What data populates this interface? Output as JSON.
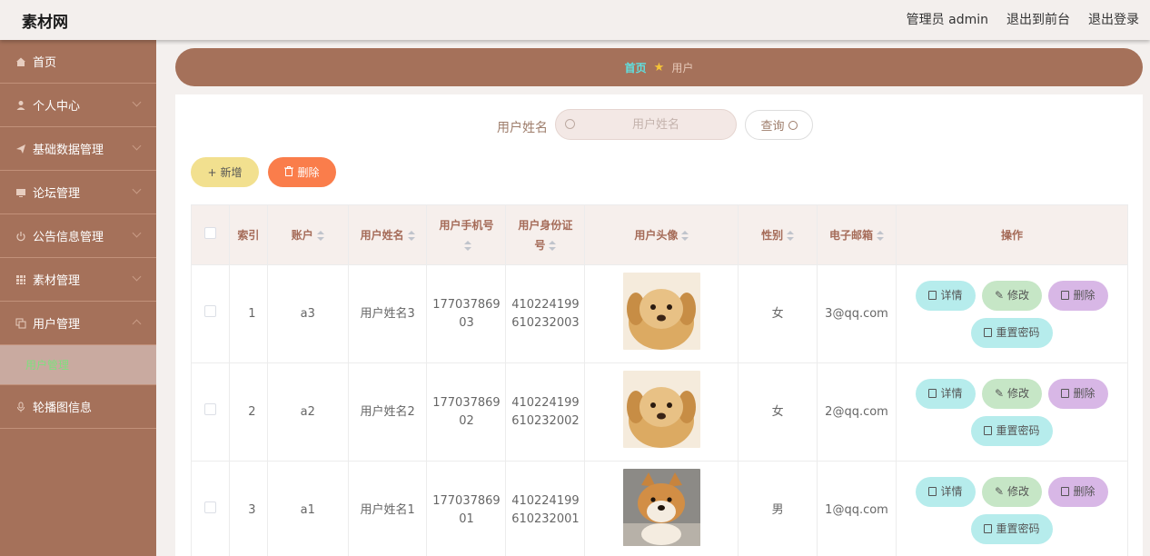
{
  "app": {
    "title": "素材网"
  },
  "header": {
    "admin_label": "管理员 admin",
    "frontend_link": "退出到前台",
    "logout_link": "退出登录"
  },
  "sidebar": {
    "items": [
      {
        "label": "首页",
        "icon": "home-icon"
      },
      {
        "label": "个人中心",
        "icon": "user-icon"
      },
      {
        "label": "基础数据管理",
        "icon": "send-icon"
      },
      {
        "label": "论坛管理",
        "icon": "monitor-icon"
      },
      {
        "label": "公告信息管理",
        "icon": "power-icon"
      },
      {
        "label": "素材管理",
        "icon": "grid-icon"
      },
      {
        "label": "用户管理",
        "icon": "copy-icon"
      },
      {
        "label": "轮播图信息",
        "icon": "mic-icon"
      }
    ],
    "active_sub": "用户管理"
  },
  "breadcrumb": {
    "home": "首页",
    "current": "用户"
  },
  "search": {
    "label": "用户姓名",
    "placeholder": "用户姓名",
    "value": "",
    "button_label": "查询"
  },
  "toolbar": {
    "add_label": "新增",
    "delete_label": "删除"
  },
  "table": {
    "headers": {
      "index": "索引",
      "account": "账户",
      "name": "用户姓名",
      "phone_line1": "用户手机号",
      "idcard_line1": "用户身份证",
      "idcard_line2": "号",
      "avatar": "用户头像",
      "gender": "性别",
      "email": "电子邮箱",
      "actions": "操作"
    },
    "rows": [
      {
        "index": "1",
        "account": "a3",
        "name": "用户姓名3",
        "phone_l1": "177037869",
        "phone_l2": "03",
        "id_l1": "410224199",
        "id_l2": "610232003",
        "avatar": "golden-puppy",
        "gender": "女",
        "email": "3@qq.com"
      },
      {
        "index": "2",
        "account": "a2",
        "name": "用户姓名2",
        "phone_l1": "177037869",
        "phone_l2": "02",
        "id_l1": "410224199",
        "id_l2": "610232002",
        "avatar": "golden-puppy",
        "gender": "女",
        "email": "2@qq.com"
      },
      {
        "index": "3",
        "account": "a1",
        "name": "用户姓名1",
        "phone_l1": "177037869",
        "phone_l2": "01",
        "id_l1": "410224199",
        "id_l2": "610232001",
        "avatar": "shiba-dog",
        "gender": "男",
        "email": "1@qq.com"
      }
    ],
    "actions": {
      "detail": "详情",
      "edit": "修改",
      "delete": "删除",
      "reset": "重置密码"
    }
  },
  "colors": {
    "sidebar": "#a5715a",
    "accent_cyan": "#5fe0e0",
    "add_button": "#f2e08f",
    "delete_button": "#fa7d4b",
    "header_text": "#a56b58"
  }
}
